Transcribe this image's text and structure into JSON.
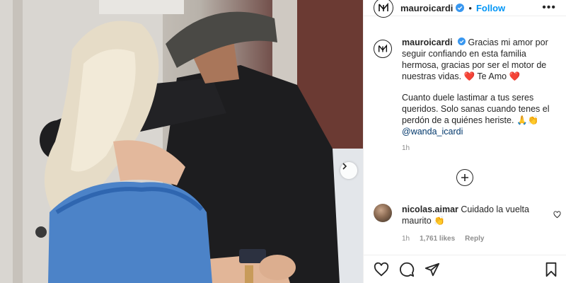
{
  "post": {
    "username": "mauroicardi",
    "follow_label": "Follow",
    "separator": "•",
    "more_label": "•••"
  },
  "caption": {
    "username": "mauroicardi",
    "line1": "Gracias mi amor por seguir confiando en esta familia hermosa, gracias por ser el motor de nuestras vidas.",
    "heart1": "❤️",
    "te_amo": "Te Amo",
    "heart2": "❤️",
    "line2": "Cuanto duele lastimar a tus seres queridos. Solo sanas cuando tenes el perdón de a quiénes heriste.",
    "emoji": "🙏👏",
    "mention": "@wanda_icardi",
    "time": "1h"
  },
  "comment": {
    "username": "nicolas.aimar",
    "text": "Cuidado la vuelta maurito",
    "emoji": "👏",
    "time": "1h",
    "likes": "1,761 likes",
    "reply": "Reply"
  },
  "icons": {
    "verified": "verified-badge-icon",
    "heart": "heart-icon",
    "comment": "comment-icon",
    "share": "share-icon",
    "save": "bookmark-icon",
    "add": "plus-circle-icon",
    "next": "chevron-right-icon"
  },
  "colors": {
    "accent": "#0095f6",
    "verified": "#3897f0",
    "heart": "#ed4956",
    "muted": "#8e8e8e"
  }
}
